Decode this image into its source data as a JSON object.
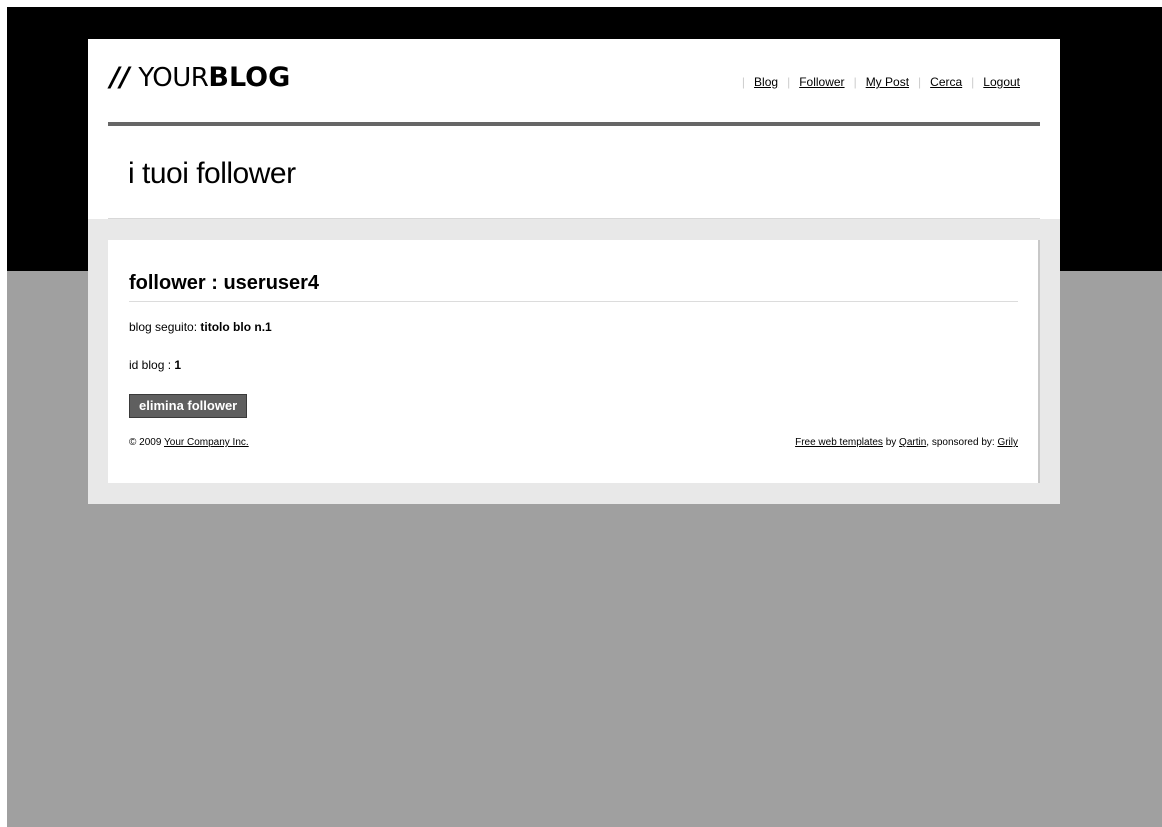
{
  "logo": {
    "slashes": "//",
    "your": "YOUR",
    "blog": "BLOG"
  },
  "nav": {
    "items": [
      {
        "label": "Blog"
      },
      {
        "label": "Follower"
      },
      {
        "label": "My Post"
      },
      {
        "label": "Cerca"
      },
      {
        "label": "Logout"
      }
    ]
  },
  "page_title": "i tuoi follower",
  "follower": {
    "title": "follower : useruser4",
    "blog_label": "blog seguito: ",
    "blog_value": "titolo blo n.1",
    "id_label": "id blog : ",
    "id_value": "1",
    "delete_label": "elimina follower"
  },
  "footer": {
    "copyright": "© 2009 ",
    "company_link": "Your Company Inc.",
    "templates_link": "Free web templates",
    "by_text": " by ",
    "author_link": "Qartin",
    "sponsored_text": ", sponsored by: ",
    "sponsor_link": "Grily"
  },
  "colors": {
    "background_gray": "#a0a0a0",
    "top_band": "#000000",
    "rule": "#666666",
    "button": "#5f5f5f"
  }
}
